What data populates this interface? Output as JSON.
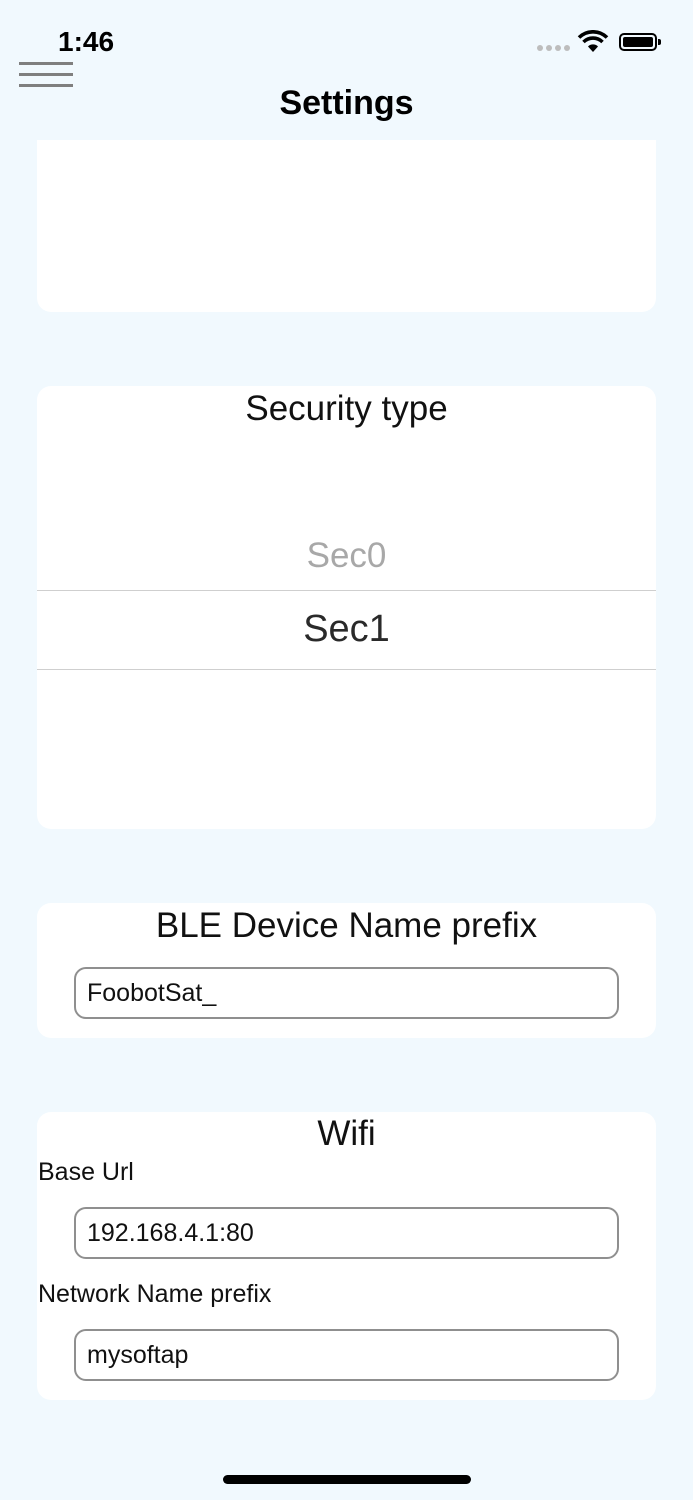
{
  "status_bar": {
    "time": "1:46"
  },
  "header": {
    "title": "Settings"
  },
  "security": {
    "title": "Security type",
    "options": [
      "Sec0",
      "Sec1"
    ],
    "selected": "Sec1"
  },
  "ble": {
    "title": "BLE Device Name prefix",
    "prefix_value": "FoobotSat_"
  },
  "wifi": {
    "title": "Wifi",
    "base_url_label": "Base Url",
    "base_url_value": "192.168.4.1:80",
    "network_label": "Network Name prefix",
    "network_value": "mysoftap"
  }
}
